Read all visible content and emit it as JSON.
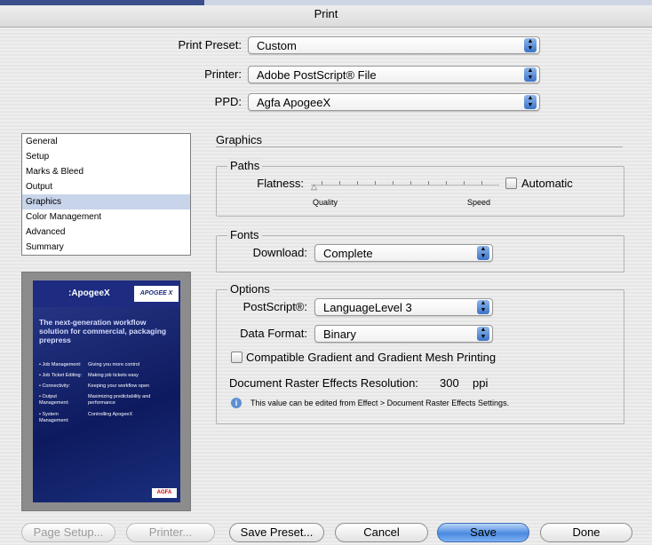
{
  "window": {
    "title": "Print"
  },
  "preset": {
    "label": "Print Preset:",
    "value": "Custom"
  },
  "printer": {
    "label": "Printer:",
    "value": "Adobe PostScript® File"
  },
  "ppd": {
    "label": "PPD:",
    "value": "Agfa ApogeeX"
  },
  "sidebar": {
    "items": [
      "General",
      "Setup",
      "Marks & Bleed",
      "Output",
      "Graphics",
      "Color Management",
      "Advanced",
      "Summary"
    ],
    "selected": "Graphics"
  },
  "preview": {
    "brand": ":ApogeeX",
    "logo": "APOGEE X",
    "headline": "The next-generation workflow solution for commercial, packaging prepress",
    "bullets": [
      {
        "k": "• Job Management:",
        "v": "Giving you more control"
      },
      {
        "k": "• Job Ticket Editing:",
        "v": "Making job tickets easy"
      },
      {
        "k": "• Connectivity:",
        "v": "Keeping your workflow open"
      },
      {
        "k": "• Output Management:",
        "v": "Maximizing predictability and performance"
      },
      {
        "k": "• System Management:",
        "v": "Controlling ApogeeX"
      }
    ],
    "footer_logo": "AGFA"
  },
  "graphics": {
    "title": "Graphics",
    "paths": {
      "group_label": "Paths",
      "flatness_label": "Flatness:",
      "quality_label": "Quality",
      "speed_label": "Speed",
      "automatic_label": "Automatic",
      "slider_level": 0
    },
    "fonts": {
      "group_label": "Fonts",
      "download_label": "Download:",
      "download_value": "Complete"
    },
    "options": {
      "group_label": "Options",
      "postscript_label": "PostScript®:",
      "postscript_value": "LanguageLevel 3",
      "data_format_label": "Data Format:",
      "data_format_value": "Binary",
      "compatible_label": "Compatible Gradient and Gradient Mesh Printing",
      "resolution_label": "Document Raster Effects Resolution:",
      "resolution_value": "300",
      "resolution_unit": "ppi",
      "info_text": "This value can be edited from Effect > Document Raster Effects Settings."
    }
  },
  "buttons": {
    "page_setup": "Page Setup...",
    "printer": "Printer...",
    "save_preset": "Save Preset...",
    "cancel": "Cancel",
    "save": "Save",
    "done": "Done"
  }
}
